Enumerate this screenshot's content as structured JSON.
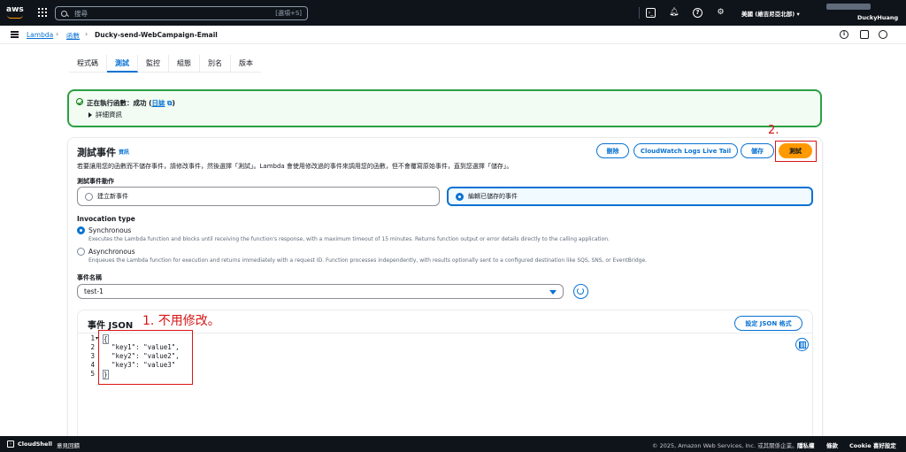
{
  "topnav": {
    "logo": "aws",
    "search_placeholder": "搜尋",
    "search_shortcut": "[選項+S]",
    "region": "美國 (維吉尼亞北部) ▾",
    "account": "DuckyHuang"
  },
  "breadcrumb": {
    "items": [
      "Lambda",
      "函數",
      "Ducky-send-WebCampaign-Email"
    ]
  },
  "tabs": [
    "程式碼",
    "測試",
    "監控",
    "組態",
    "別名",
    "版本"
  ],
  "active_tab": "測試",
  "banner": {
    "prefix": "正在執行函數：成功 (",
    "link": "日誌",
    "suffix": ")",
    "details": "詳細資訊"
  },
  "test_event": {
    "title": "測試事件",
    "info": "資訊",
    "description": "若要讓用您的函數而不儲存事件，請修改事件，然後選擇「測試」。Lambda 會使用修改過的事件來調用您的函數，但不會覆寫原始事件，直到您選擇「儲存」。",
    "buttons": {
      "delete": "刪除",
      "tail": "CloudWatch Logs Live Tail",
      "save": "儲存",
      "test": "測試"
    },
    "action_label": "測試事件動作",
    "actions": [
      {
        "label": "建立新事件",
        "selected": false
      },
      {
        "label": "編輯已儲存的事件",
        "selected": true
      }
    ],
    "invocation_label": "Invocation type",
    "invocations": [
      {
        "label": "Synchronous",
        "desc": "Executes the Lambda function and blocks until receiving the function's response, with a maximum timeout of 15 minutes. Returns function output or error details directly to the calling application.",
        "selected": true
      },
      {
        "label": "Asynchronous",
        "desc": "Enqueues the Lambda function for execution and returns immediately with a request ID. Function processes independently, with results optionally sent to a configured destination like SQS, SNS, or EventBridge.",
        "selected": false
      }
    ],
    "event_name_label": "事件名稱",
    "event_name": "test-1"
  },
  "editor": {
    "title": "事件 JSON",
    "format_button": "設定 JSON 格式",
    "lines": [
      {
        "n": "1",
        "text": "{"
      },
      {
        "n": "2",
        "text": "  \"key1\": \"value1\","
      },
      {
        "n": "3",
        "text": "  \"key2\": \"value2\","
      },
      {
        "n": "4",
        "text": "  \"key3\": \"value3\""
      },
      {
        "n": "5",
        "text": "}"
      }
    ]
  },
  "annotations": {
    "a1": "1. 不用修改。",
    "a2": "2."
  },
  "footer": {
    "cloudshell": "CloudShell",
    "feedback": "意見回饋",
    "copyright": "© 2025, Amazon Web Services, Inc. 或其關係企業。",
    "privacy": "隱私權",
    "terms": "條款",
    "cookie": "Cookie 喜好設定"
  },
  "colors": {
    "nav_bg": "#0f141a",
    "link": "#0972d3",
    "primary": "#ff9900",
    "success": "#2c9f45",
    "annotation": "#d91515"
  }
}
